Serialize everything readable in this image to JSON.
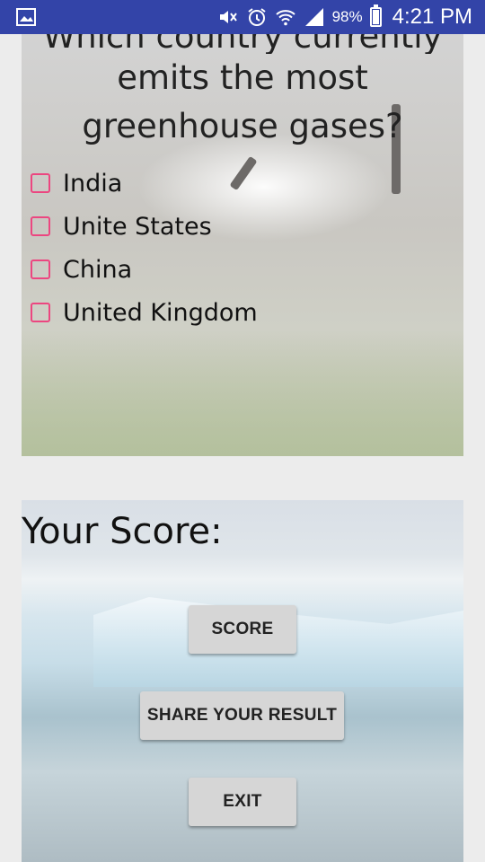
{
  "status_bar": {
    "battery": "98%",
    "time": "4:21 PM",
    "icons": [
      "image-icon",
      "mute-icon",
      "alarm-icon",
      "wifi-icon",
      "signal-icon",
      "battery-icon"
    ]
  },
  "question": {
    "line_partial": "Which country currently",
    "text": "emits the most greenhouse gases?"
  },
  "options": [
    {
      "label": "India",
      "checked": false
    },
    {
      "label": "Unite States",
      "checked": false
    },
    {
      "label": "China",
      "checked": false
    },
    {
      "label": "United Kingdom",
      "checked": false
    }
  ],
  "score_section": {
    "title": "Your Score:",
    "score_button": "SCORE",
    "share_button": "SHARE YOUR RESULT",
    "exit_button": "EXIT"
  },
  "colors": {
    "status_bar": "#3344a8",
    "checkbox": "#ec4680",
    "button": "#d6d6d6"
  }
}
